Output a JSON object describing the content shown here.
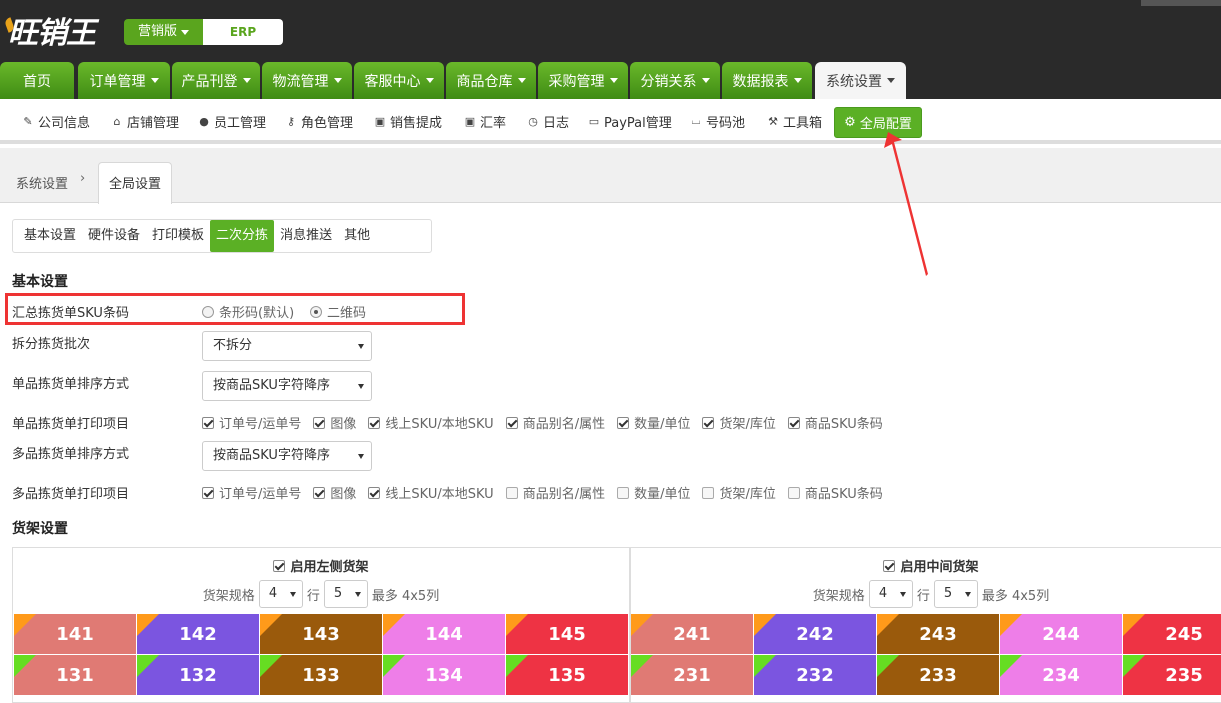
{
  "header": {
    "logo": "旺销王",
    "version_label": "营销版",
    "erp_label": "ERP"
  },
  "nav": {
    "tabs": [
      {
        "label": "首页"
      },
      {
        "label": "订单管理"
      },
      {
        "label": "产品刊登"
      },
      {
        "label": "物流管理"
      },
      {
        "label": "客服中心"
      },
      {
        "label": "商品仓库"
      },
      {
        "label": "采购管理"
      },
      {
        "label": "分销关系"
      },
      {
        "label": "数据报表"
      },
      {
        "label": "系统设置"
      }
    ]
  },
  "subnav": {
    "items": [
      {
        "label": "公司信息",
        "icon": "edit-icon"
      },
      {
        "label": "店铺管理",
        "icon": "home-icon"
      },
      {
        "label": "员工管理",
        "icon": "user-icon"
      },
      {
        "label": "角色管理",
        "icon": "key-icon"
      },
      {
        "label": "销售提成",
        "icon": "money-icon"
      },
      {
        "label": "汇率",
        "icon": "money-icon"
      },
      {
        "label": "日志",
        "icon": "clock-icon"
      },
      {
        "label": "PayPal管理",
        "icon": "credit-card-icon"
      },
      {
        "label": "号码池",
        "icon": "inbox-icon"
      },
      {
        "label": "工具箱",
        "icon": "wrench-icon"
      },
      {
        "label": "全局配置",
        "icon": "gear-icon"
      }
    ]
  },
  "breadcrumb": {
    "root": "系统设置",
    "current": "全局设置"
  },
  "settings_tabs": [
    "基本设置",
    "硬件设备",
    "打印模板",
    "二次分拣",
    "消息推送",
    "其他"
  ],
  "basic": {
    "heading": "基本设置",
    "sku_barcode_label": "汇总拣货单SKU条码",
    "radio_barcode": "条形码(默认)",
    "radio_qrcode": "二维码",
    "split_label": "拆分拣货批次",
    "split_value": "不拆分",
    "single_sort_label": "单品拣货单排序方式",
    "single_sort_value": "按商品SKU字符降序",
    "single_print_label": "单品拣货单打印项目",
    "multi_sort_label": "多品拣货单排序方式",
    "multi_sort_value": "按商品SKU字符降序",
    "multi_print_label": "多品拣货单打印项目",
    "print_items": [
      "订单号/运单号",
      "图像",
      "线上SKU/本地SKU",
      "商品别名/属性",
      "数量/单位",
      "货架/库位",
      "商品SKU条码"
    ],
    "single_checked": [
      true,
      true,
      true,
      true,
      true,
      true,
      true
    ],
    "multi_checked": [
      true,
      true,
      true,
      false,
      false,
      false,
      false
    ]
  },
  "shelf": {
    "heading": "货架设置",
    "left": {
      "title": "启用左侧货架",
      "spec_label": "货架规格",
      "rows": "4",
      "row_word": "行",
      "cols": "5",
      "max_text": "最多 4x5列",
      "row1": [
        "141",
        "142",
        "143",
        "144",
        "145"
      ],
      "row2": [
        "131",
        "132",
        "133",
        "134",
        "135"
      ]
    },
    "middle": {
      "title": "启用中间货架",
      "spec_label": "货架规格",
      "rows": "4",
      "row_word": "行",
      "cols": "5",
      "max_text": "最多 4x5列",
      "row1": [
        "241",
        "242",
        "243",
        "244",
        "245"
      ],
      "row2": [
        "231",
        "232",
        "233",
        "234",
        "235"
      ]
    },
    "cell_colors": [
      "#e07a74",
      "#7b55e0",
      "#9a5a0c",
      "#ee7ee8",
      "#ee3344"
    ],
    "row1_corner": "#ff9a1a",
    "row2_corner": "#66dd22"
  },
  "colors": {
    "brand_green": "#5bb025",
    "annotation_red": "#ee3333"
  }
}
